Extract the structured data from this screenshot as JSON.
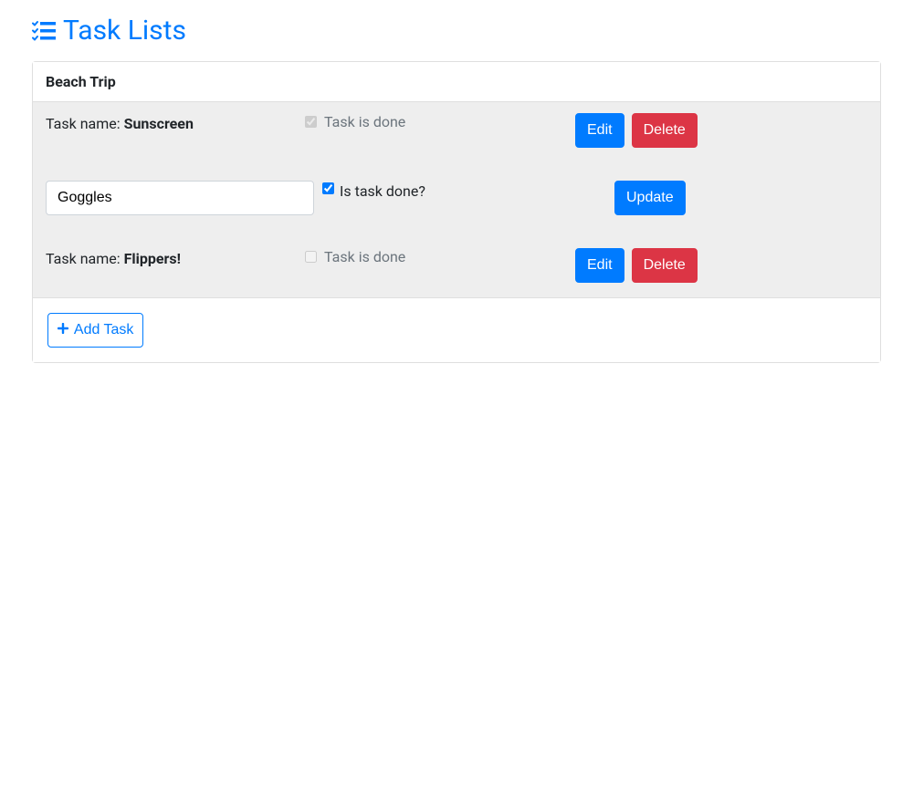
{
  "page": {
    "title": "Task Lists"
  },
  "taskList": {
    "title": "Beach Trip"
  },
  "labels": {
    "task_name_prefix": "Task name: ",
    "task_is_done": "Task is done",
    "is_task_done_q": "Is task done?",
    "edit": "Edit",
    "delete": "Delete",
    "update": "Update",
    "add_task": "Add Task"
  },
  "tasks": [
    {
      "name": "Sunscreen",
      "done": true,
      "mode": "view"
    },
    {
      "name": "Goggles",
      "done": true,
      "mode": "edit"
    },
    {
      "name": "Flippers!",
      "done": false,
      "mode": "view"
    }
  ]
}
